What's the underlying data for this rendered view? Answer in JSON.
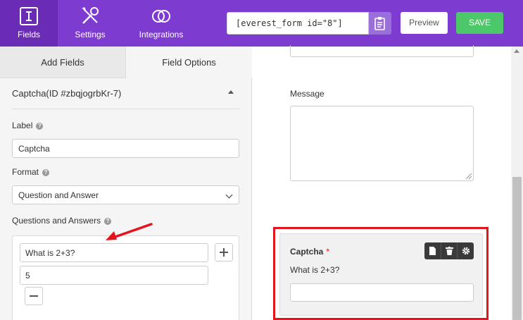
{
  "topbar": {
    "tabs": [
      {
        "label": "Fields",
        "icon": "fields-icon"
      },
      {
        "label": "Settings",
        "icon": "settings-icon"
      },
      {
        "label": "Integrations",
        "icon": "integrations-icon"
      }
    ],
    "shortcode": "[everest_form id=\"8\"]",
    "preview_label": "Preview",
    "save_label": "SAVE",
    "colors": {
      "bar": "#7e3bd0",
      "save": "#4cc76a"
    }
  },
  "panel": {
    "tabs": [
      "Add Fields",
      "Field Options"
    ],
    "section_title": "Captcha(ID #zbqjogrbKr-7)",
    "label_label": "Label",
    "label_value": "Captcha",
    "format_label": "Format",
    "format_value": "Question and Answer",
    "qa_label": "Questions and Answers",
    "question": "What is 2+3?",
    "answer": "5"
  },
  "preview": {
    "message_label": "Message",
    "captcha_label": "Captcha",
    "required_mark": "*",
    "captcha_question": "What is 2+3?",
    "highlight_color": "#e3141b"
  }
}
